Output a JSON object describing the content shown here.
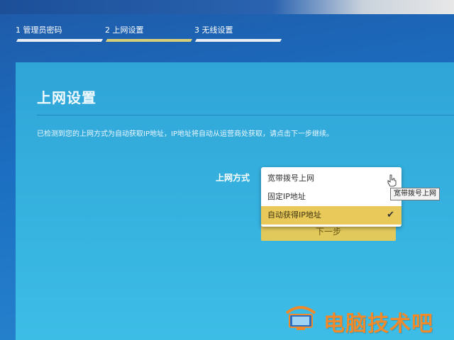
{
  "steps": [
    {
      "label": "1 管理员密码",
      "active": false
    },
    {
      "label": "2 上网设置",
      "active": true
    },
    {
      "label": "3 无线设置",
      "active": false
    }
  ],
  "page": {
    "title": "上网设置",
    "info": "已检测到您的上网方式为自动获取IP地址，IP地址将自动从运营商处获取，请点击下一步继续。",
    "field_label": "上网方式"
  },
  "dropdown": {
    "options": [
      "宽带拨号上网",
      "固定IP地址",
      "自动获得IP地址"
    ],
    "selected_index": 2
  },
  "tooltip": "宽带拨号上网",
  "next_button": "下一步",
  "watermark": "电脑技术吧",
  "colors": {
    "accent_yellow": "#e9c95a",
    "card_blue": "#35b0de",
    "watermark_orange": "#f08a2a"
  }
}
